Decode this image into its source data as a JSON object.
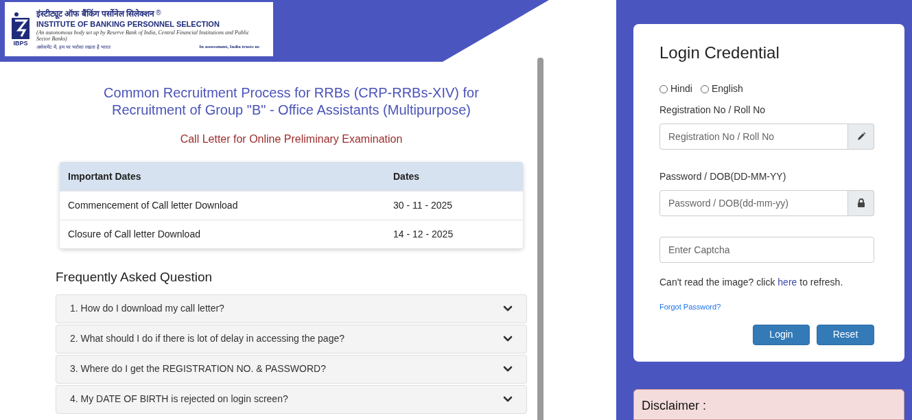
{
  "logo": {
    "mark": "IBPS",
    "hindi_name": "इंस्टीट्यूट ऑफ बैंकिंग पर्सोनेल सिलेक्शन",
    "registered": "®",
    "name": "INSTITUTE OF BANKING PERSONNEL SELECTION",
    "subtitle": "(An autonomous body set up by Reserve Bank of India, Central Financial Institutions and Public Sector Banks)",
    "hindi_tagline": "असेसमेंट में, हम पर भरोसा रखता है भारत",
    "tagline": "In assessment, India trusts us"
  },
  "heading": "Common Recruitment Process for RRBs (CRP-RRBs-XIV) for Recruitment of Group \"B\" - Office Assistants (Multipurpose)",
  "subheading": "Call Letter for Online Preliminary Examination",
  "dates_table": {
    "columns": [
      "Important Dates",
      "Dates"
    ],
    "rows": [
      {
        "event": "Commencement of Call letter Download",
        "date": "30 - 11 - 2025"
      },
      {
        "event": "Closure of Call letter Download",
        "date": "14 - 12 - 2025"
      }
    ]
  },
  "faq": {
    "title": "Frequently Asked Question",
    "items": [
      {
        "question": "1. How do I download my call letter?",
        "expanded": false
      },
      {
        "question": "2. What should I do if there is lot of delay in accessing the page?",
        "expanded": false
      },
      {
        "question": "3. Where do I get the REGISTRATION NO. & PASSWORD?",
        "expanded": false
      },
      {
        "question": "4. My DATE OF BIRTH is rejected on login screen?",
        "expanded": false
      }
    ]
  },
  "login": {
    "title": "Login Credential",
    "languages": [
      {
        "label": "Hindi",
        "selected": false
      },
      {
        "label": "English",
        "selected": false
      }
    ],
    "fields": [
      {
        "label": "Registration No / Roll No",
        "placeholder": "Registration No / Roll No",
        "kind": "pencil"
      },
      {
        "label": "Password / DOB(DD-MM-YY)",
        "placeholder": "Password / DOB(dd-mm-yy)",
        "kind": "lock"
      },
      {
        "placeholder": "Enter Captcha",
        "kind": "plain"
      }
    ],
    "refresh_text": {
      "before": "Can't read the image? click ",
      "link": "here",
      "after": " to refresh."
    },
    "forgot": "Forgot Password?",
    "buttons": [
      "Login",
      "Reset"
    ]
  },
  "disclaimer": {
    "title": "Disclaimer :"
  }
}
